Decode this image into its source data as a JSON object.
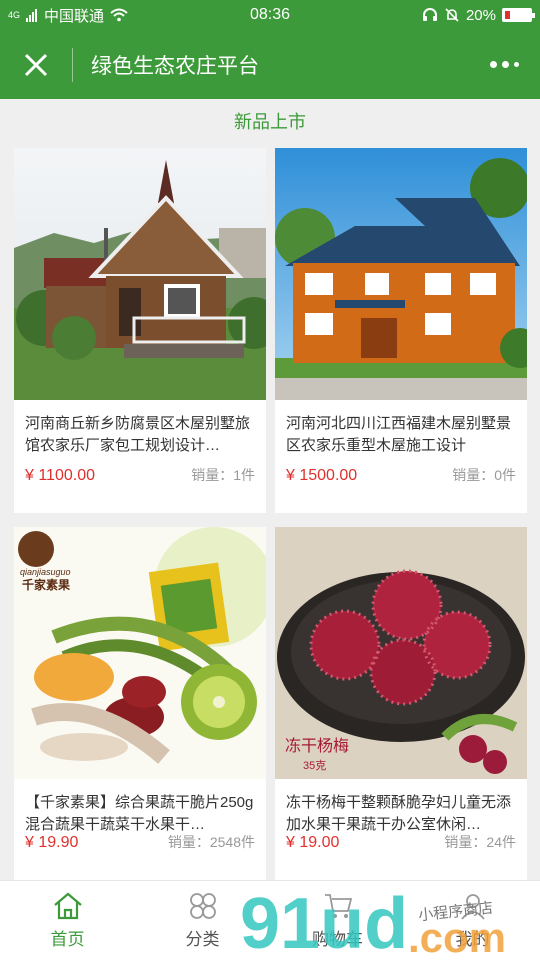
{
  "status": {
    "network_badge": "4G",
    "carrier": "中国联通",
    "time": "08:36",
    "battery": "20%",
    "battery_level": 0.2,
    "battery_color": "#e0302d"
  },
  "header": {
    "title": "绿色生态农庄平台",
    "bg_color": "#3d9a3a"
  },
  "section": {
    "title": "新品上市"
  },
  "products": [
    {
      "name": "河南商丘新乡防腐景区木屋别墅旅馆农家乐厂家包工规划设计…",
      "price": "¥ 1100.00",
      "sales": "销量：1件"
    },
    {
      "name": "河南河北四川江西福建木屋别墅景区农家乐重型木屋施工设计",
      "price": "¥ 1500.00",
      "sales": "销量：0件"
    },
    {
      "name": "【千家素果】综合果蔬干脆片250g混合蔬果干蔬菜干水果干…",
      "price": "¥ 19.90",
      "sales": "销量：2548件",
      "image_text": [
        "qianjiasuguo",
        "千家素果"
      ]
    },
    {
      "name": "冻干杨梅干整颗酥脆孕妇儿童无添加水果干果蔬干办公室休闲…",
      "price": "¥ 19.00",
      "sales": "销量：24件",
      "image_text": [
        "冻干杨梅",
        "35克"
      ]
    }
  ],
  "tabs": [
    {
      "label": "首页",
      "icon": "home-icon",
      "active": true
    },
    {
      "label": "分类",
      "icon": "category-icon",
      "active": false
    },
    {
      "label": "购物车",
      "icon": "cart-icon",
      "active": false
    },
    {
      "label": "我的",
      "icon": "user-icon",
      "active": false
    }
  ],
  "watermark": {
    "main": "91ud",
    "suffix": ".com",
    "script": "小程序商店"
  }
}
